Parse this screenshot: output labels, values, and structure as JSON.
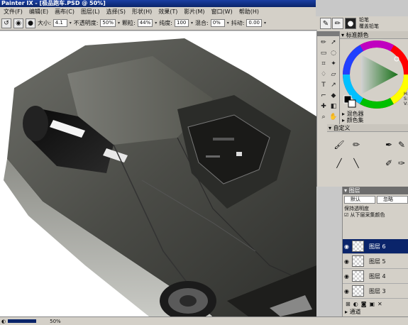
{
  "window": {
    "title": "Painter IX - [极品跑车.PSD @ 50%]"
  },
  "menu": {
    "items": [
      "文件(F)",
      "编辑(E)",
      "画布(C)",
      "图层(L)",
      "选择(S)",
      "形状(H)",
      "效果(T)",
      "影片(M)",
      "窗口(W)",
      "帮助(H)"
    ]
  },
  "property_bar": {
    "size_label": "大小:",
    "size_value": "4.1",
    "opacity_label": "不透明度:",
    "opacity_value": "50%",
    "grain_label": "颗粒:",
    "grain_value": "44%",
    "resat_label": "纯度:",
    "resat_value": "100",
    "bleed_label": "混合:",
    "bleed_value": "0%",
    "jitter_label": "抖动:",
    "jitter_value": "0.00"
  },
  "brush_selector": {
    "category": "铅笔",
    "variant": "覆盖铅笔"
  },
  "color_panel": {
    "title": "标准颜色",
    "h": "H:",
    "s": "S:",
    "v": "V:",
    "colors": {
      "primary": "#000000",
      "secondary": "#ffffff",
      "ring_note": "hue-ring",
      "triangle": "#2e8b2e"
    }
  },
  "mixer": {
    "label": "混色器"
  },
  "color_set": {
    "label": "颜色集"
  },
  "brushes": {
    "label": "自定义"
  },
  "layers": {
    "title": "图层",
    "composite_method": "默认",
    "blend_mode": "忽略",
    "preserve_transparency": "保持透明度",
    "pick_up_underlying": "从下层采集颜色",
    "items": [
      {
        "name": "图层 6",
        "selected": true
      },
      {
        "name": "图层 5",
        "selected": false
      },
      {
        "name": "图层 4",
        "selected": false
      },
      {
        "name": "图层 3",
        "selected": false
      }
    ]
  },
  "channels": {
    "label": "通道"
  },
  "status": {
    "zoom": "50%"
  }
}
